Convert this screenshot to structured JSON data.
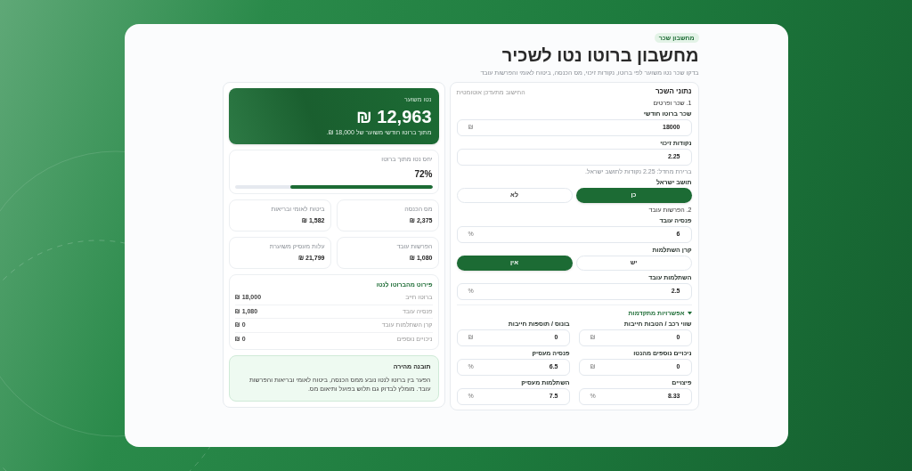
{
  "header": {
    "badge": "מחשבון שכר",
    "title": "מחשבון ברוטו נטו לשכיר",
    "subtitle": "בדקו שכר נטו משוער לפי ברוטו, נקודות זיכוי, מס הכנסה, ביטוח לאומי והפרשות עובד"
  },
  "summary": {
    "label": "נטו משוער",
    "amount": "12,963 ₪",
    "note": "מתוך ברוטו חודשי משוער של 18,000 ₪."
  },
  "ratio": {
    "label": "יחס נטו מתוך ברוטו",
    "value": "72%",
    "level": 0.72
  },
  "stats": [
    {
      "label": "מס הכנסה",
      "value": "2,375 ₪"
    },
    {
      "label": "ביטוח לאומי ובריאות",
      "value": "1,582 ₪"
    },
    {
      "label": "הפרשות עובד",
      "value": "1,080 ₪"
    },
    {
      "label": "עלות מעסיק משוערת",
      "value": "21,799 ₪"
    }
  ],
  "breakdown": {
    "title": "פירוט מהברוטו לנטו",
    "rows": [
      {
        "label": "ברוטו חייב",
        "value": "₪ 18,000"
      },
      {
        "label": "פנסיה עובד",
        "value": "₪ 1,080"
      },
      {
        "label": "קרן השתלמות עובד",
        "value": "₪ 0"
      },
      {
        "label": "ניכויים נוספים",
        "value": "₪ 0"
      }
    ]
  },
  "tip": {
    "title": "תובנה מהירה",
    "text": "הפער בין ברוטו לנטו נובע ממס הכנסה, ביטוח לאומי ובריאות והפרשות עובד. מומלץ לבדוק גם תלוש בפועל ותיאום מס."
  },
  "form": {
    "title": "נתוני השכר",
    "note": "החישוב מתעדכן אוטומטית",
    "sections": [
      {
        "heading": "1. שכר ופרטים",
        "fields": [
          {
            "kind": "input",
            "label": "שכר ברוטו חודשי",
            "value": "18000",
            "unit": "₪"
          },
          {
            "kind": "input",
            "label": "נקודות זיכוי",
            "value": "2.25",
            "hint": "ברירת מחדל: 2.25 נקודות לתושב ישראל."
          },
          {
            "kind": "toggle",
            "label": "תושב ישראל",
            "options": [
              {
                "label": "כן",
                "selected": true
              },
              {
                "label": "לא",
                "selected": false
              }
            ]
          }
        ]
      },
      {
        "heading": "2. הפרשות עובד",
        "fields": [
          {
            "kind": "input",
            "label": "פנסיה עובד",
            "value": "6",
            "unit": "%"
          },
          {
            "kind": "toggle",
            "label": "קרן השתלמות",
            "options": [
              {
                "label": "יש",
                "selected": false
              },
              {
                "label": "אין",
                "selected": true
              }
            ]
          },
          {
            "kind": "input",
            "label": "השתלמות עובד",
            "value": "2.5",
            "unit": "%"
          }
        ]
      }
    ],
    "advanced": {
      "label": "אפשרויות מתקדמות",
      "expanded": true,
      "fields": [
        {
          "label": "שווי רכב / הטבות חייבות",
          "value": "0",
          "unit": "₪"
        },
        {
          "label": "בונוס / תוספות חייבות",
          "value": "0",
          "unit": "₪"
        },
        {
          "label": "ניכויים נוספים מהנטו",
          "value": "0",
          "unit": "₪"
        },
        {
          "label": "פנסיה מעסיק",
          "value": "6.5",
          "unit": "%"
        },
        {
          "label": "פיצויים",
          "value": "8.33",
          "unit": "%"
        },
        {
          "label": "השתלמות מעסיק",
          "value": "7.5",
          "unit": "%"
        }
      ]
    }
  }
}
